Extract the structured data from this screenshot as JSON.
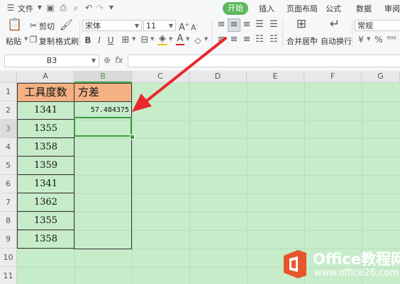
{
  "menubar": {
    "file_label": "文件",
    "tabs": [
      "开始",
      "插入",
      "页面布局",
      "公式",
      "数据",
      "审阅"
    ]
  },
  "ribbon": {
    "paste_label": "粘贴",
    "cut_label": "剪切",
    "copy_label": "复制",
    "format_painter_label": "格式刷",
    "font_name": "宋体",
    "font_size": "11",
    "merge_center_label": "合并居中",
    "wrap_text_label": "自动换行",
    "number_format": "常规"
  },
  "formula_bar": {
    "name_box": "B3",
    "fx_label": "fx",
    "formula": ""
  },
  "grid": {
    "columns": [
      "A",
      "B",
      "C",
      "D",
      "E",
      "F",
      "G"
    ],
    "rows": [
      "1",
      "2",
      "3",
      "4",
      "5",
      "6",
      "7",
      "8",
      "9",
      "10",
      "11"
    ],
    "active_column": "B",
    "active_row": "3",
    "header_a": "工具度数",
    "header_b": "方差",
    "values_a": [
      "1341",
      "1355",
      "1358",
      "1359",
      "1341",
      "1362",
      "1355",
      "1358"
    ],
    "b2_value": "57.484375"
  },
  "colors": {
    "header_fill": "#f4b183",
    "sheet_background": "#c7ecca",
    "selection": "#3c9a3c",
    "active_tab": "#5db85c",
    "arrow": "#e8282b"
  },
  "watermark": {
    "line1": "Office教程网",
    "line2": "www.office26.com"
  }
}
